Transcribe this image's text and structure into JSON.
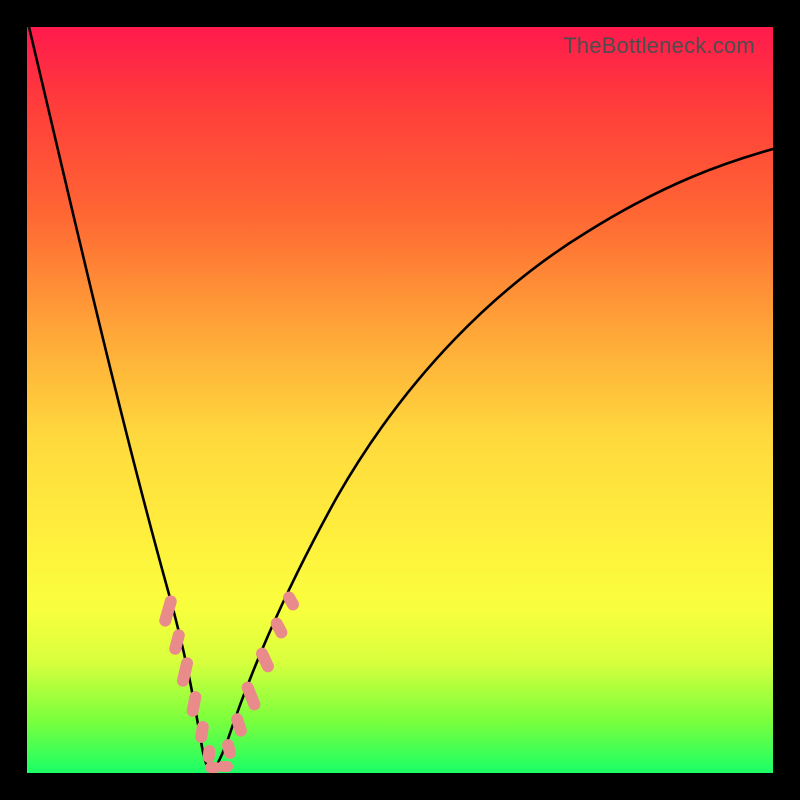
{
  "header": {
    "watermark": "TheBottleneck.com"
  },
  "colors": {
    "frame": "#000000",
    "curve": "#000000",
    "spots": "#e98b8b",
    "gradient_top": "#ff1a4d",
    "gradient_bottom": "#1aff66"
  },
  "chart_data": {
    "type": "line",
    "title": "",
    "xlabel": "",
    "ylabel": "",
    "xlim": [
      0,
      100
    ],
    "ylim": [
      0,
      100
    ],
    "grid": false,
    "note": "Bottleneck-style V-curve; background gradient encodes value (red=bad top, green=good bottom); optimal point at curve minimum.",
    "series": [
      {
        "name": "bottleneck-curve",
        "x": [
          0,
          2,
          4,
          6,
          8,
          10,
          12,
          14,
          16,
          18,
          20,
          22,
          24,
          26,
          28,
          30,
          35,
          40,
          45,
          50,
          55,
          60,
          65,
          70,
          75,
          80,
          85,
          90,
          95,
          100
        ],
        "y": [
          100,
          92,
          84,
          76,
          68,
          60,
          51,
          42,
          33,
          24,
          14,
          6,
          1,
          2,
          6,
          12,
          23,
          33,
          42,
          50,
          57,
          63,
          68,
          72,
          75,
          78,
          80,
          82,
          83,
          84
        ]
      }
    ],
    "highlight_spots": {
      "name": "near-optimal-points",
      "note": "Salmon capsule markers clustered around the curve minimum on both arms.",
      "points": [
        {
          "x": 18.5,
          "y": 21
        },
        {
          "x": 19.5,
          "y": 16
        },
        {
          "x": 20.5,
          "y": 11
        },
        {
          "x": 21.5,
          "y": 7
        },
        {
          "x": 22.5,
          "y": 3.5
        },
        {
          "x": 23.2,
          "y": 1.2
        },
        {
          "x": 24.0,
          "y": 0.8
        },
        {
          "x": 24.8,
          "y": 1.2
        },
        {
          "x": 26.3,
          "y": 3.5
        },
        {
          "x": 28.0,
          "y": 8
        },
        {
          "x": 30.0,
          "y": 13
        },
        {
          "x": 32.0,
          "y": 18
        }
      ]
    }
  }
}
